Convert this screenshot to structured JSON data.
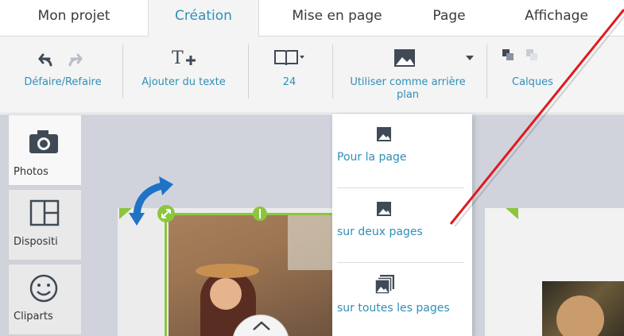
{
  "tabs": [
    {
      "label": "Mon projet"
    },
    {
      "label": "Création"
    },
    {
      "label": "Mise en page"
    },
    {
      "label": "Page"
    },
    {
      "label": "Affichage"
    }
  ],
  "toolbar": {
    "undo_redo_label": "Défaire/Refaire",
    "add_text_label": "Ajouter du texte",
    "page_count_label": "24",
    "background_label_line1": "Utiliser comme arrière",
    "background_label_line2": "plan",
    "layers_label": "Calques"
  },
  "sidebar": {
    "items": [
      {
        "label": "Photos",
        "icon": "camera-icon"
      },
      {
        "label": "Dispositi",
        "icon": "layout-icon"
      },
      {
        "label": "Cliparts",
        "icon": "smiley-icon"
      }
    ]
  },
  "dropdown": {
    "items": [
      {
        "label": "Pour la page",
        "icon": "image-icon"
      },
      {
        "label": "sur deux pages",
        "icon": "image-icon"
      },
      {
        "label": "sur toutes les pages",
        "icon": "images-stack-icon"
      }
    ]
  },
  "colors": {
    "accent": "#2f8fb8",
    "selection": "#8cc63f",
    "annotation": "#e0191f",
    "rotate_arrow": "#1f73c7",
    "canvas": "#d0d3dc"
  }
}
